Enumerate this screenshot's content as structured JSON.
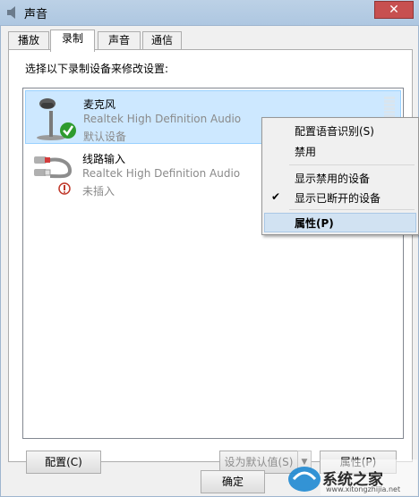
{
  "window": {
    "title": "声音",
    "close_label": "✕"
  },
  "tabs": [
    {
      "label": "播放",
      "active": false
    },
    {
      "label": "录制",
      "active": true
    },
    {
      "label": "声音",
      "active": false
    },
    {
      "label": "通信",
      "active": false
    }
  ],
  "instruction": "选择以下录制设备来修改设置:",
  "devices": [
    {
      "name": "麦克风",
      "driver": "Realtek High Definition Audio",
      "status": "默认设备",
      "selected": true,
      "icon": "microphone-icon",
      "badge": "default-check-icon"
    },
    {
      "name": "线路输入",
      "driver": "Realtek High Definition Audio",
      "status": "未插入",
      "selected": false,
      "icon": "line-in-cable-icon",
      "badge": "unplugged-icon"
    }
  ],
  "context_menu": {
    "items": [
      {
        "label": "配置语音识别(S)"
      },
      {
        "label": "禁用"
      },
      {
        "label": "显示禁用的设备"
      },
      {
        "label": "显示已断开的设备",
        "checked": true
      },
      {
        "label": "属性(P)",
        "highlighted": true
      }
    ]
  },
  "buttons": {
    "configure": "配置(C)",
    "set_default": "设为默认值(S)",
    "properties": "属性(P)",
    "ok": "确定"
  },
  "watermark": {
    "text": "系统之家",
    "url": "www.xitongzhijia.net"
  },
  "colors": {
    "selected_row": "#cde8ff",
    "menu_highlight": "#d1e2f2",
    "close_button": "#c75050",
    "check_badge": "#2e9b2e",
    "unplug_badge": "#c0392b"
  }
}
